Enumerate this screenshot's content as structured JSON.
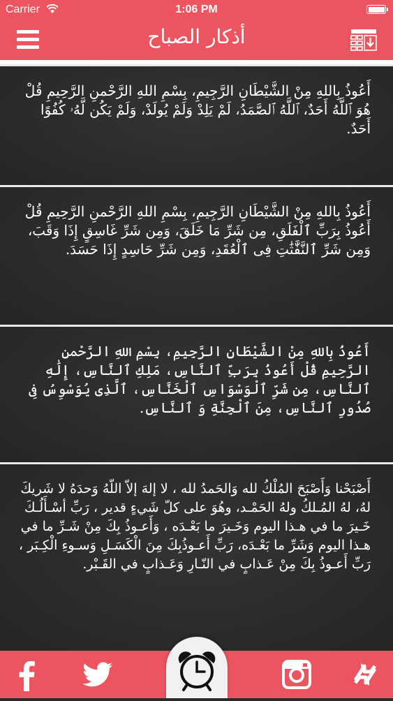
{
  "status_bar": {
    "carrier": "Carrier",
    "time": "1:06 PM"
  },
  "nav": {
    "title": "أذكار الصباح",
    "menu_icon": "hamburger-menu-icon",
    "calendar_icon": "calendar-download-icon"
  },
  "colors": {
    "accent": "#ec5560",
    "card_background": "#2b2b2b",
    "divider": "#e9e9e9"
  },
  "adhkar": [
    {
      "text": "أَعُوذُ بِاللهِ مِنْ الشَّيْطَانِ الرَّجِيمِ، بِسْمِ اللهِ الرَّحْمنِ الرَّحِيمِ قُلْ هُوَ ٱللَّهُ أَحَدٌ، ٱللَّهُ ٱلصَّمَدُ، لَمْ يَلِدْ وَلَمْ يُولَدْ، وَلَمْ يَكُن لَّهُۥ كُفُوًا أَحَدٌ."
    },
    {
      "text": "أَعُوذُ بِاللهِ مِنْ الشَّيْطَانِ الرَّجِيمِ، بِسْمِ اللهِ الرَّحْمنِ الرَّحِيمِ قُلْ أَعُوذُ بِرَبِّ ٱلْفَلَقِ، مِن شَرِّ مَا خَلَقَ، وَمِن شَرِّ غَاسِقٍ إِذَا وَقَبَ، وَمِن شَرِّ ٱلنَّفَّٰثَٰتِ فِى ٱلْعُقَدِ، وَمِن شَرِّ حَاسِدٍ إِذَا حَسَدَ."
    },
    {
      "text": "أَعُوذُ بِاللهِ مِنْ الشَّيْطَانِ الرَّجِيمِ، بِسْمِ اللهِ الرَّحْمنِ الرَّحِيمِ قُلْ أَعُوذُ بِرَبِّ ٱلنَّاسِ، مَلِكِ ٱلنَّاسِ، إِلَٰهِ ٱلنَّاسِ، مِن شَرِّ ٱلْوَسْوَاسِ ٱلْخَنَّاسِ، ٱلَّذِى يُوَسْوِسُ فِى صُدُورِ ٱلنَّاسِ، مِنَ ٱلْجِنَّةِ وَ ٱلنَّاسِ."
    },
    {
      "text": "أَصْبَحْنا وَأَصْبَحَ المُلْكُ لله وَالحَمدُ لله ، لا إلهَ إلاّ اللّهُ وَحدَهُ لا شَريكَ لهُ، لهُ المُـلكُ ولهُ الحَمْـد، وهُوَ على كلّ شَيءٍ قدير ، رَبِّ أسْـأَلُـكَ خَـيرَ ما في هـذا اليوم وَخَـيرَ ما بَعْـدَه ، وَأَعـوذُ بِكَ مِنْ شَـرِّ ما في هـذا اليوم وَشَرِّ ما بَعْـدَه، رَبِّ أَعـوذُبِكَ مِنَ الْكَسَـلِ وَسـوءِ الْكِـبَر ، رَبِّ أَعـوذُ بِكَ مِنْ عَـذابٍ في النّـارِ وَعَـذابٍ في القَـبْر."
    }
  ],
  "tab_bar": {
    "items": [
      {
        "icon": "facebook-icon"
      },
      {
        "icon": "twitter-icon"
      },
      {
        "icon": "alarm-clock-icon"
      },
      {
        "icon": "instagram-icon"
      },
      {
        "icon": "shuffle-arrows-icon"
      }
    ]
  }
}
